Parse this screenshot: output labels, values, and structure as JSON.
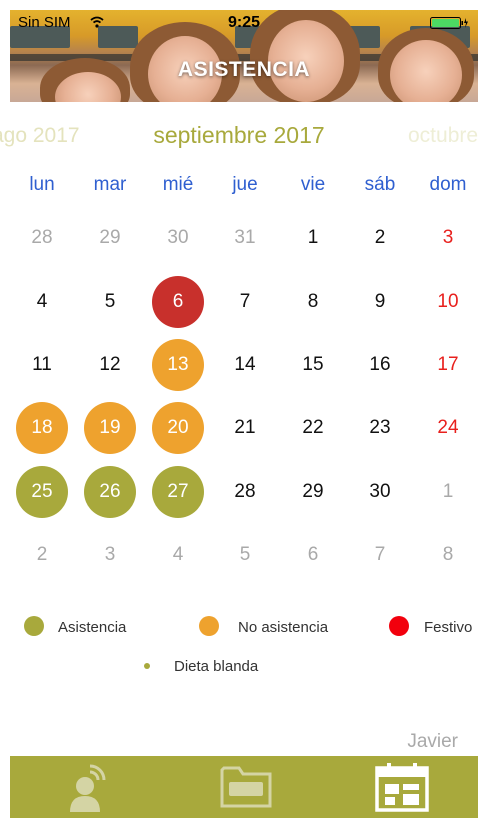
{
  "status_bar": {
    "carrier": "Sin SIM",
    "time": "9:25"
  },
  "header": {
    "title": "ASISTENCIA"
  },
  "calendar": {
    "prev_month": "ago 2017",
    "current_month": "septiembre 2017",
    "next_month": "octubre",
    "weekdays": [
      "lun",
      "mar",
      "mié",
      "jue",
      "vie",
      "sáb",
      "dom"
    ],
    "weeks": [
      [
        {
          "d": "28",
          "s": "other"
        },
        {
          "d": "29",
          "s": "other"
        },
        {
          "d": "30",
          "s": "other"
        },
        {
          "d": "31",
          "s": "other"
        },
        {
          "d": "1",
          "s": ""
        },
        {
          "d": "2",
          "s": ""
        },
        {
          "d": "3",
          "s": "sunday"
        }
      ],
      [
        {
          "d": "4",
          "s": ""
        },
        {
          "d": "5",
          "s": ""
        },
        {
          "d": "6",
          "s": "festivo"
        },
        {
          "d": "7",
          "s": ""
        },
        {
          "d": "8",
          "s": ""
        },
        {
          "d": "9",
          "s": ""
        },
        {
          "d": "10",
          "s": "sunday"
        }
      ],
      [
        {
          "d": "11",
          "s": ""
        },
        {
          "d": "12",
          "s": ""
        },
        {
          "d": "13",
          "s": "noasis"
        },
        {
          "d": "14",
          "s": ""
        },
        {
          "d": "15",
          "s": ""
        },
        {
          "d": "16",
          "s": ""
        },
        {
          "d": "17",
          "s": "sunday"
        }
      ],
      [
        {
          "d": "18",
          "s": "noasis"
        },
        {
          "d": "19",
          "s": "noasis"
        },
        {
          "d": "20",
          "s": "noasis"
        },
        {
          "d": "21",
          "s": ""
        },
        {
          "d": "22",
          "s": ""
        },
        {
          "d": "23",
          "s": ""
        },
        {
          "d": "24",
          "s": "sunday"
        }
      ],
      [
        {
          "d": "25",
          "s": "asis"
        },
        {
          "d": "26",
          "s": "asis"
        },
        {
          "d": "27",
          "s": "asis"
        },
        {
          "d": "28",
          "s": ""
        },
        {
          "d": "29",
          "s": ""
        },
        {
          "d": "30",
          "s": ""
        },
        {
          "d": "1",
          "s": "other"
        }
      ],
      [
        {
          "d": "2",
          "s": "other"
        },
        {
          "d": "3",
          "s": "other"
        },
        {
          "d": "4",
          "s": "other"
        },
        {
          "d": "5",
          "s": "other"
        },
        {
          "d": "6",
          "s": "other"
        },
        {
          "d": "7",
          "s": "other"
        },
        {
          "d": "8",
          "s": "other"
        }
      ]
    ]
  },
  "legend": {
    "asistencia": "Asistencia",
    "no_asistencia": "No asistencia",
    "festivo": "Festivo",
    "dieta_blanda": "Dieta blanda"
  },
  "colors": {
    "asistencia": "#a8a93c",
    "no_asistencia": "#eea22e",
    "festivo": "#c8302c",
    "festivo_legend": "#f2000d",
    "weekday_text": "#2f5fd0",
    "sunday_text": "#e8201d",
    "tabbar": "#a8a93c"
  },
  "user": {
    "name": "Javier"
  },
  "tabbar": {
    "tabs": [
      {
        "icon": "person-signal-icon"
      },
      {
        "icon": "folder-icon"
      },
      {
        "icon": "calendar-icon"
      }
    ]
  }
}
